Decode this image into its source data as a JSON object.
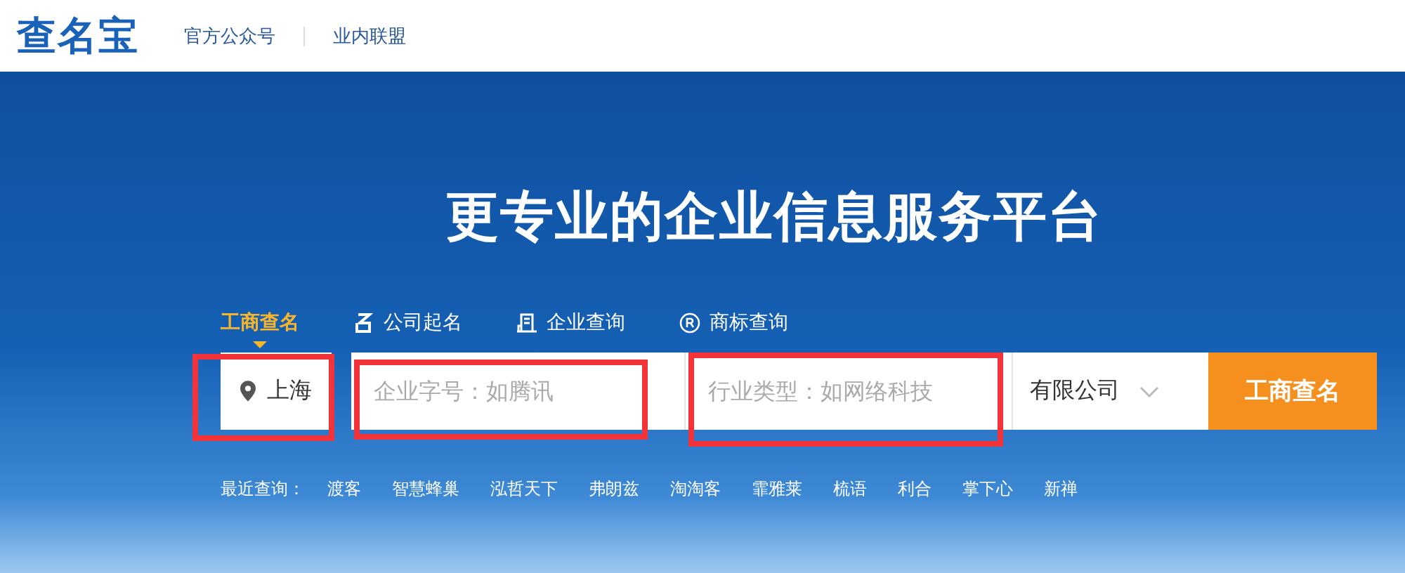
{
  "header": {
    "logo": "查名宝",
    "links": [
      "官方公众号",
      "业内联盟"
    ]
  },
  "hero": {
    "title": "更专业的企业信息服务平台"
  },
  "tabs": [
    {
      "kind": "none",
      "label": "工商查名",
      "selected": true
    },
    {
      "kind": "name",
      "label": "公司起名",
      "selected": false
    },
    {
      "kind": "building",
      "label": "企业查询",
      "selected": false
    },
    {
      "kind": "trademark",
      "label": "商标查询",
      "selected": false
    }
  ],
  "search": {
    "location": {
      "value": "上海",
      "highlighted": true
    },
    "company_name": {
      "placeholder": "企业字号：如腾讯",
      "highlighted": true
    },
    "industry": {
      "placeholder": "行业类型：如网络科技",
      "highlighted": true
    },
    "company_type": {
      "value": "有限公司"
    },
    "button": "工商查名"
  },
  "recent": {
    "label": "最近查询：",
    "items": [
      "渡客",
      "智慧蜂巢",
      "泓哲天下",
      "弗朗兹",
      "淘淘客",
      "霏雅莱",
      "梳语",
      "利合",
      "掌下心",
      "新禅"
    ]
  }
}
